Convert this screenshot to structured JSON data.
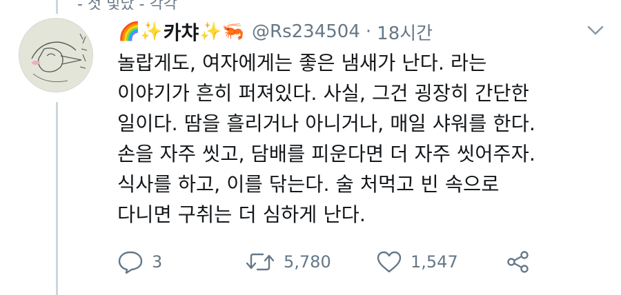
{
  "previous_tweet_fragment": "- 첫 빛났 - 각각",
  "tweet": {
    "author": {
      "name_emoji_left": "🌈✨",
      "name": "카챠",
      "name_emoji_right": "✨🦐",
      "handle": "@Rs234504",
      "separator": "·",
      "time": "18시간"
    },
    "text_lines": [
      "놀랍게도, 여자에게는 좋은 냄새가 난다. 라는",
      "이야기가 흔히 퍼져있다. 사실, 그건 굉장히 간단한",
      "일이다. 땀을 흘리거나 아니거나, 매일 샤워를 한다.",
      "손을 자주 씻고, 담배를 피운다면 더 자주 씻어주자.",
      "식사를 하고, 이를 닦는다. 술 처먹고 빈 속으로",
      "다니면 구취는 더 심하게  난다."
    ],
    "actions": {
      "reply_count": "3",
      "retweet_count": "5,780",
      "like_count": "1,547"
    }
  },
  "icons": {
    "caret": "chevron-down-icon",
    "reply": "reply-icon",
    "retweet": "retweet-icon",
    "like": "heart-icon",
    "share": "share-icon"
  },
  "colors": {
    "text": "#14171a",
    "secondary": "#657786",
    "thread_line": "#ccd6dd"
  }
}
